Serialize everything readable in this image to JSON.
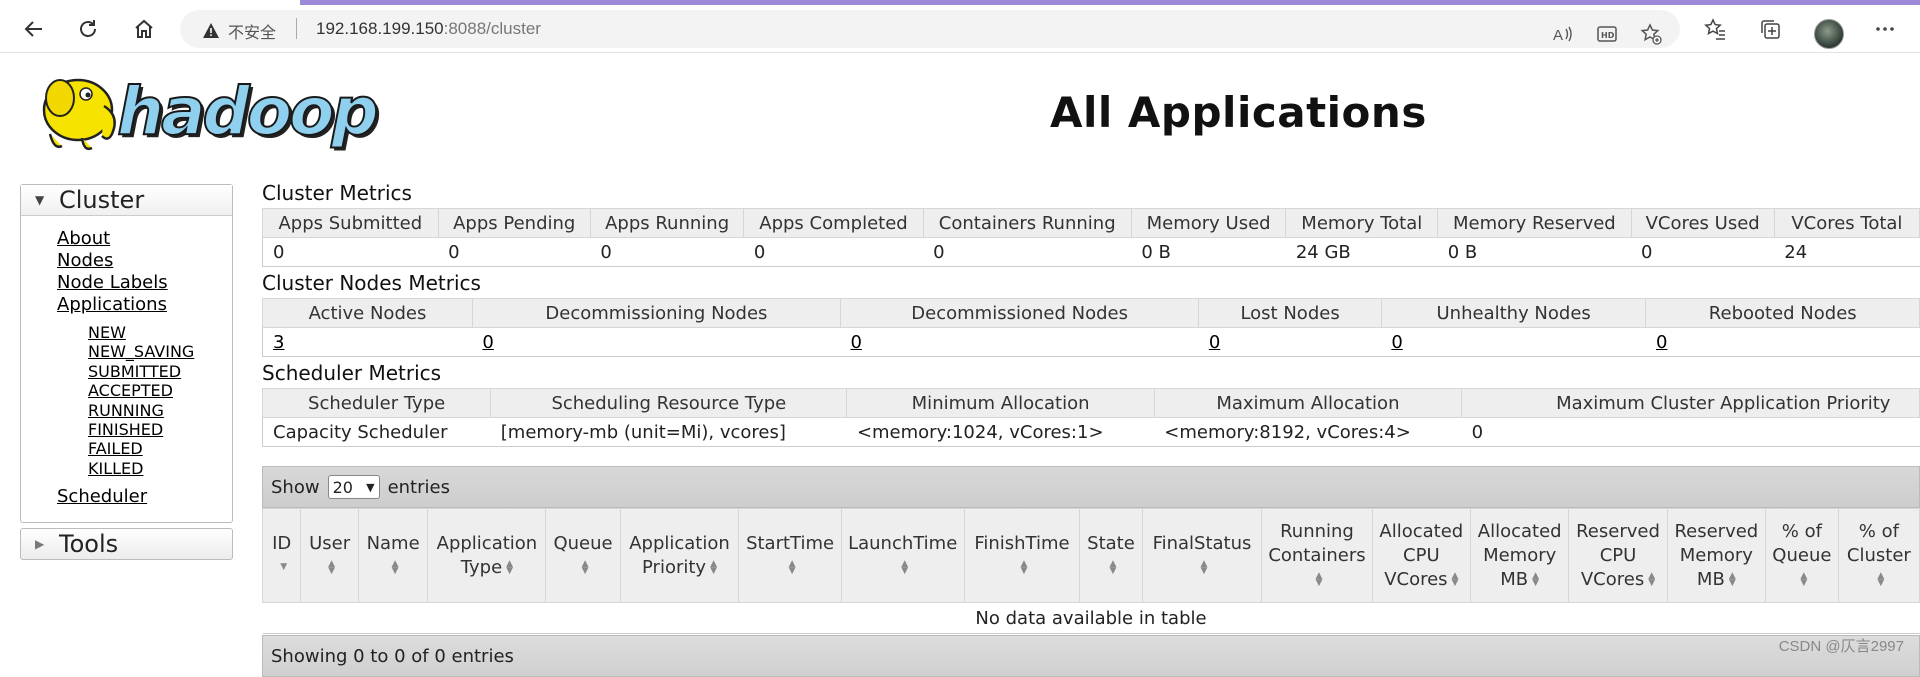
{
  "browser": {
    "insecure_label": "不安全",
    "url_host": "192.168.199.150",
    "url_rest": ":8088/cluster",
    "accent": "#9c8ad6"
  },
  "page": {
    "title": "All Applications",
    "logo_text": "hadoop"
  },
  "sidebar": {
    "cluster_label": "Cluster",
    "links": [
      "About",
      "Nodes",
      "Node Labels",
      "Applications"
    ],
    "app_states": [
      "NEW",
      "NEW_SAVING",
      "SUBMITTED",
      "ACCEPTED",
      "RUNNING",
      "FINISHED",
      "FAILED",
      "KILLED"
    ],
    "scheduler_label": "Scheduler",
    "tools_label": "Tools"
  },
  "cluster_metrics": {
    "title": "Cluster Metrics",
    "headers": [
      "Apps Submitted",
      "Apps Pending",
      "Apps Running",
      "Apps Completed",
      "Containers Running",
      "Memory Used",
      "Memory Total",
      "Memory Reserved",
      "VCores Used",
      "VCores Total"
    ],
    "values": [
      "0",
      "0",
      "0",
      "0",
      "0",
      "0 B",
      "24 GB",
      "0 B",
      "0",
      "24"
    ]
  },
  "nodes_metrics": {
    "title": "Cluster Nodes Metrics",
    "headers": [
      "Active Nodes",
      "Decommissioning Nodes",
      "Decommissioned Nodes",
      "Lost Nodes",
      "Unhealthy Nodes",
      "Rebooted Nodes"
    ],
    "values": [
      "3",
      "0",
      "0",
      "0",
      "0",
      "0"
    ]
  },
  "scheduler_metrics": {
    "title": "Scheduler Metrics",
    "headers": [
      "Scheduler Type",
      "Scheduling Resource Type",
      "Minimum Allocation",
      "Maximum Allocation",
      "Maximum Cluster Application Priority"
    ],
    "values": [
      "Capacity Scheduler",
      "[memory-mb (unit=Mi), vcores]",
      "<memory:1024, vCores:1>",
      "<memory:8192, vCores:4>",
      "0"
    ]
  },
  "apps_table": {
    "show_label": "Show",
    "show_value": "20",
    "entries_label": "entries",
    "columns": [
      "ID",
      "User",
      "Name",
      "Application Type",
      "Queue",
      "Application Priority",
      "StartTime",
      "LaunchTime",
      "FinishTime",
      "State",
      "FinalStatus",
      "Running Containers",
      "Allocated CPU VCores",
      "Allocated Memory MB",
      "Reserved CPU VCores",
      "Reserved Memory MB",
      "% of Queue",
      "% of Cluster"
    ],
    "empty_message": "No data available in table",
    "footer": "Showing 0 to 0 of 0 entries"
  },
  "watermark": "CSDN @仄言2997"
}
